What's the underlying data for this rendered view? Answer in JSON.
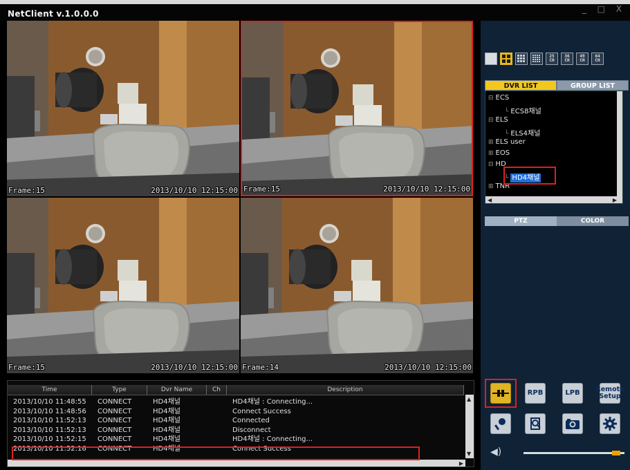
{
  "app": {
    "title": "NetClient  v.1.0.0.0",
    "controls": "_ □ X"
  },
  "tiles": [
    {
      "frame": "Frame:15",
      "timestamp": "2013/10/10 12:15:00",
      "selected": false
    },
    {
      "frame": "Frame:15",
      "timestamp": "2013/10/10 12:15:00",
      "selected": true
    },
    {
      "frame": "Frame:15",
      "timestamp": "2013/10/10 12:15:00",
      "selected": false
    },
    {
      "frame": "Frame:14",
      "timestamp": "2013/10/10 12:15:00",
      "selected": false
    }
  ],
  "log": {
    "headers": {
      "time": "Time",
      "type": "Type",
      "dvr": "Dvr Name",
      "ch": "Ch",
      "desc": "Description"
    },
    "rows": [
      {
        "time": "2013/10/10 11:48:55",
        "type": "CONNECT",
        "dvr": "HD4채널",
        "ch": "",
        "desc": "HD4채널 : Connecting..."
      },
      {
        "time": "2013/10/10 11:48:56",
        "type": "CONNECT",
        "dvr": "HD4채널",
        "ch": "",
        "desc": "Connect Success"
      },
      {
        "time": "2013/10/10 11:52:13",
        "type": "CONNECT",
        "dvr": "HD4채널",
        "ch": "",
        "desc": "Connected"
      },
      {
        "time": "2013/10/10 11:52:13",
        "type": "CONNECT",
        "dvr": "HD4채널",
        "ch": "",
        "desc": "Disconnect"
      },
      {
        "time": "2013/10/10 11:52:15",
        "type": "CONNECT",
        "dvr": "HD4채널",
        "ch": "",
        "desc": "HD4채널 : Connecting..."
      },
      {
        "time": "2013/10/10 11:52:16",
        "type": "CONNECT",
        "dvr": "HD4채널",
        "ch": "",
        "desc": "Connect Success"
      }
    ]
  },
  "layouts": {
    "ch25": "25\nCH",
    "ch36": "36\nCH",
    "ch49": "49\nCH",
    "ch64": "64\nCH"
  },
  "tabs": {
    "dvr_list": "DVR LIST",
    "group_list": "GROUP LIST"
  },
  "tree": {
    "ecs": "ECS",
    "ecs8": "ECS8채널",
    "els": "ELS",
    "els4": "ELS4채널",
    "els_user": "ELS user",
    "eos": "EOS",
    "hd": "HD",
    "hd4": "HD4채널",
    "tnr": "TNR"
  },
  "tabs2": {
    "ptz": "PTZ",
    "color": "COLOR"
  },
  "controls": {
    "rpb": "RPB",
    "lpb": "LPB",
    "remote_setup": "Remote\nSetup"
  },
  "volume": {
    "level": 0.92
  },
  "colors": {
    "accent": "#f2c81f",
    "highlight": "#e02020",
    "panel": "#0f2236",
    "selection": "#1e6fdc"
  }
}
